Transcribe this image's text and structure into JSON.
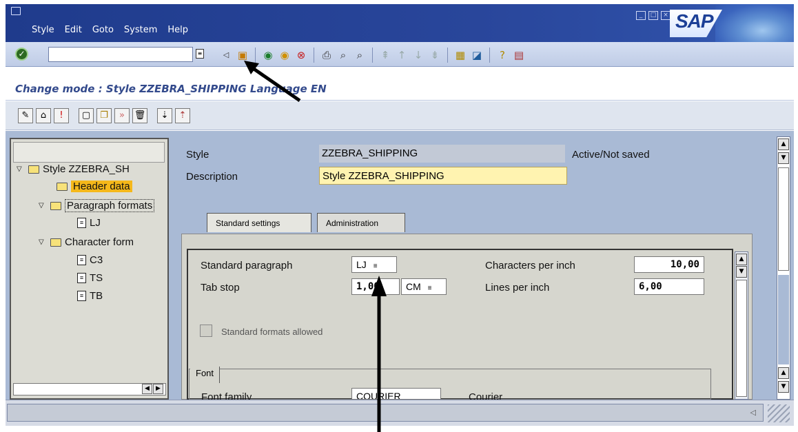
{
  "menu": [
    "Style",
    "Edit",
    "Goto",
    "System",
    "Help"
  ],
  "brand": "SAP",
  "toolbar": {
    "command_value": "",
    "icons": [
      "save-icon",
      "back-icon",
      "exit-icon",
      "cancel-icon",
      "print-icon",
      "find-icon",
      "find-next-icon",
      "first-page-icon",
      "prev-page-icon",
      "next-page-icon",
      "last-page-icon",
      "create-session-icon",
      "shortcut-icon",
      "help-icon",
      "layout-icon"
    ]
  },
  "screen_title": "Change mode : Style ZZEBRA_SHIPPING Language EN",
  "tree": {
    "root_label": "Style ZZEBRA_SH",
    "header_data": "Header data",
    "paragraph_formats": "Paragraph formats",
    "lj": "LJ",
    "character_formats": "Character form",
    "c3": "C3",
    "ts": "TS",
    "tb": "TB"
  },
  "header": {
    "style_label": "Style",
    "style_value": "ZZEBRA_SHIPPING",
    "status": "Active/Not saved",
    "description_label": "Description",
    "description_value": "Style ZZEBRA_SHIPPING"
  },
  "tabs": [
    "Standard settings",
    "Administration"
  ],
  "settings": {
    "std_paragraph_label": "Standard paragraph",
    "std_paragraph_value": "LJ",
    "tab_stop_label": "Tab stop",
    "tab_stop_value": "1,00",
    "tab_stop_unit": "CM",
    "cpi_label": "Characters per inch",
    "cpi_value": "10,00",
    "lpi_label": "Lines per inch",
    "lpi_value": "6,00",
    "std_formats_label": "Standard formats allowed",
    "font_group": "Font",
    "font_family_label": "Font family",
    "font_family_value": "COURIER",
    "font_family_desc": "Courier"
  }
}
